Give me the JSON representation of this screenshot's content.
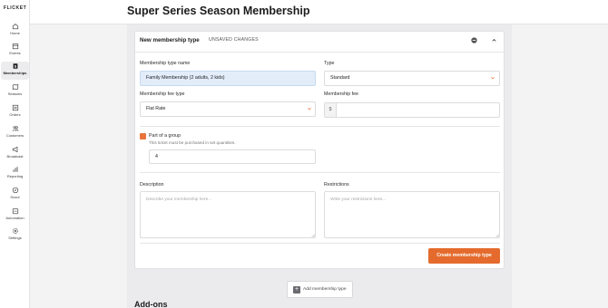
{
  "app": {
    "logo": "FLICKET"
  },
  "sidebar": {
    "items": [
      {
        "label": "Home",
        "icon": "home-icon"
      },
      {
        "label": "Events",
        "icon": "calendar-icon"
      },
      {
        "label": "Memberships",
        "icon": "membership-icon",
        "active": true
      },
      {
        "label": "Seasons",
        "icon": "map-icon"
      },
      {
        "label": "Orders",
        "icon": "orders-icon"
      },
      {
        "label": "Customers",
        "icon": "customers-icon"
      },
      {
        "label": "Broadcast",
        "icon": "broadcast-icon"
      },
      {
        "label": "Reporting",
        "icon": "reporting-icon"
      },
      {
        "label": "Scout",
        "icon": "scout-icon"
      },
      {
        "label": "Automation",
        "icon": "automation-icon"
      },
      {
        "label": "Settings",
        "icon": "settings-icon"
      }
    ]
  },
  "header": {
    "title": "Super Series Season Membership"
  },
  "card": {
    "title": "New membership type",
    "status": "UNSAVED CHANGES",
    "name_label": "Membership type name",
    "name_value": "Family Membership (2 adults, 2 kids)",
    "type_label": "Type",
    "type_value": "Standard",
    "fee_type_label": "Membership fee type",
    "fee_type_value": "Flat Rate",
    "fee_label": "Membership fee",
    "fee_prefix": "$",
    "fee_value": "",
    "group_label": "Part of a group",
    "group_checked": true,
    "group_help": "This ticket must be purchased in set quantities.",
    "group_quantity": "4",
    "description_label": "Description",
    "description_placeholder": "Describe your membership here...",
    "restrictions_label": "Restrictions",
    "restrictions_placeholder": "Write your restrictions here...",
    "submit_label": "Create membership type"
  },
  "add_button_label": "Add membership type",
  "addons_title": "Add-ons",
  "colors": {
    "accent": "#e46b2d",
    "checkbox": "#e8743b",
    "filled_input": "#e3edfa"
  }
}
